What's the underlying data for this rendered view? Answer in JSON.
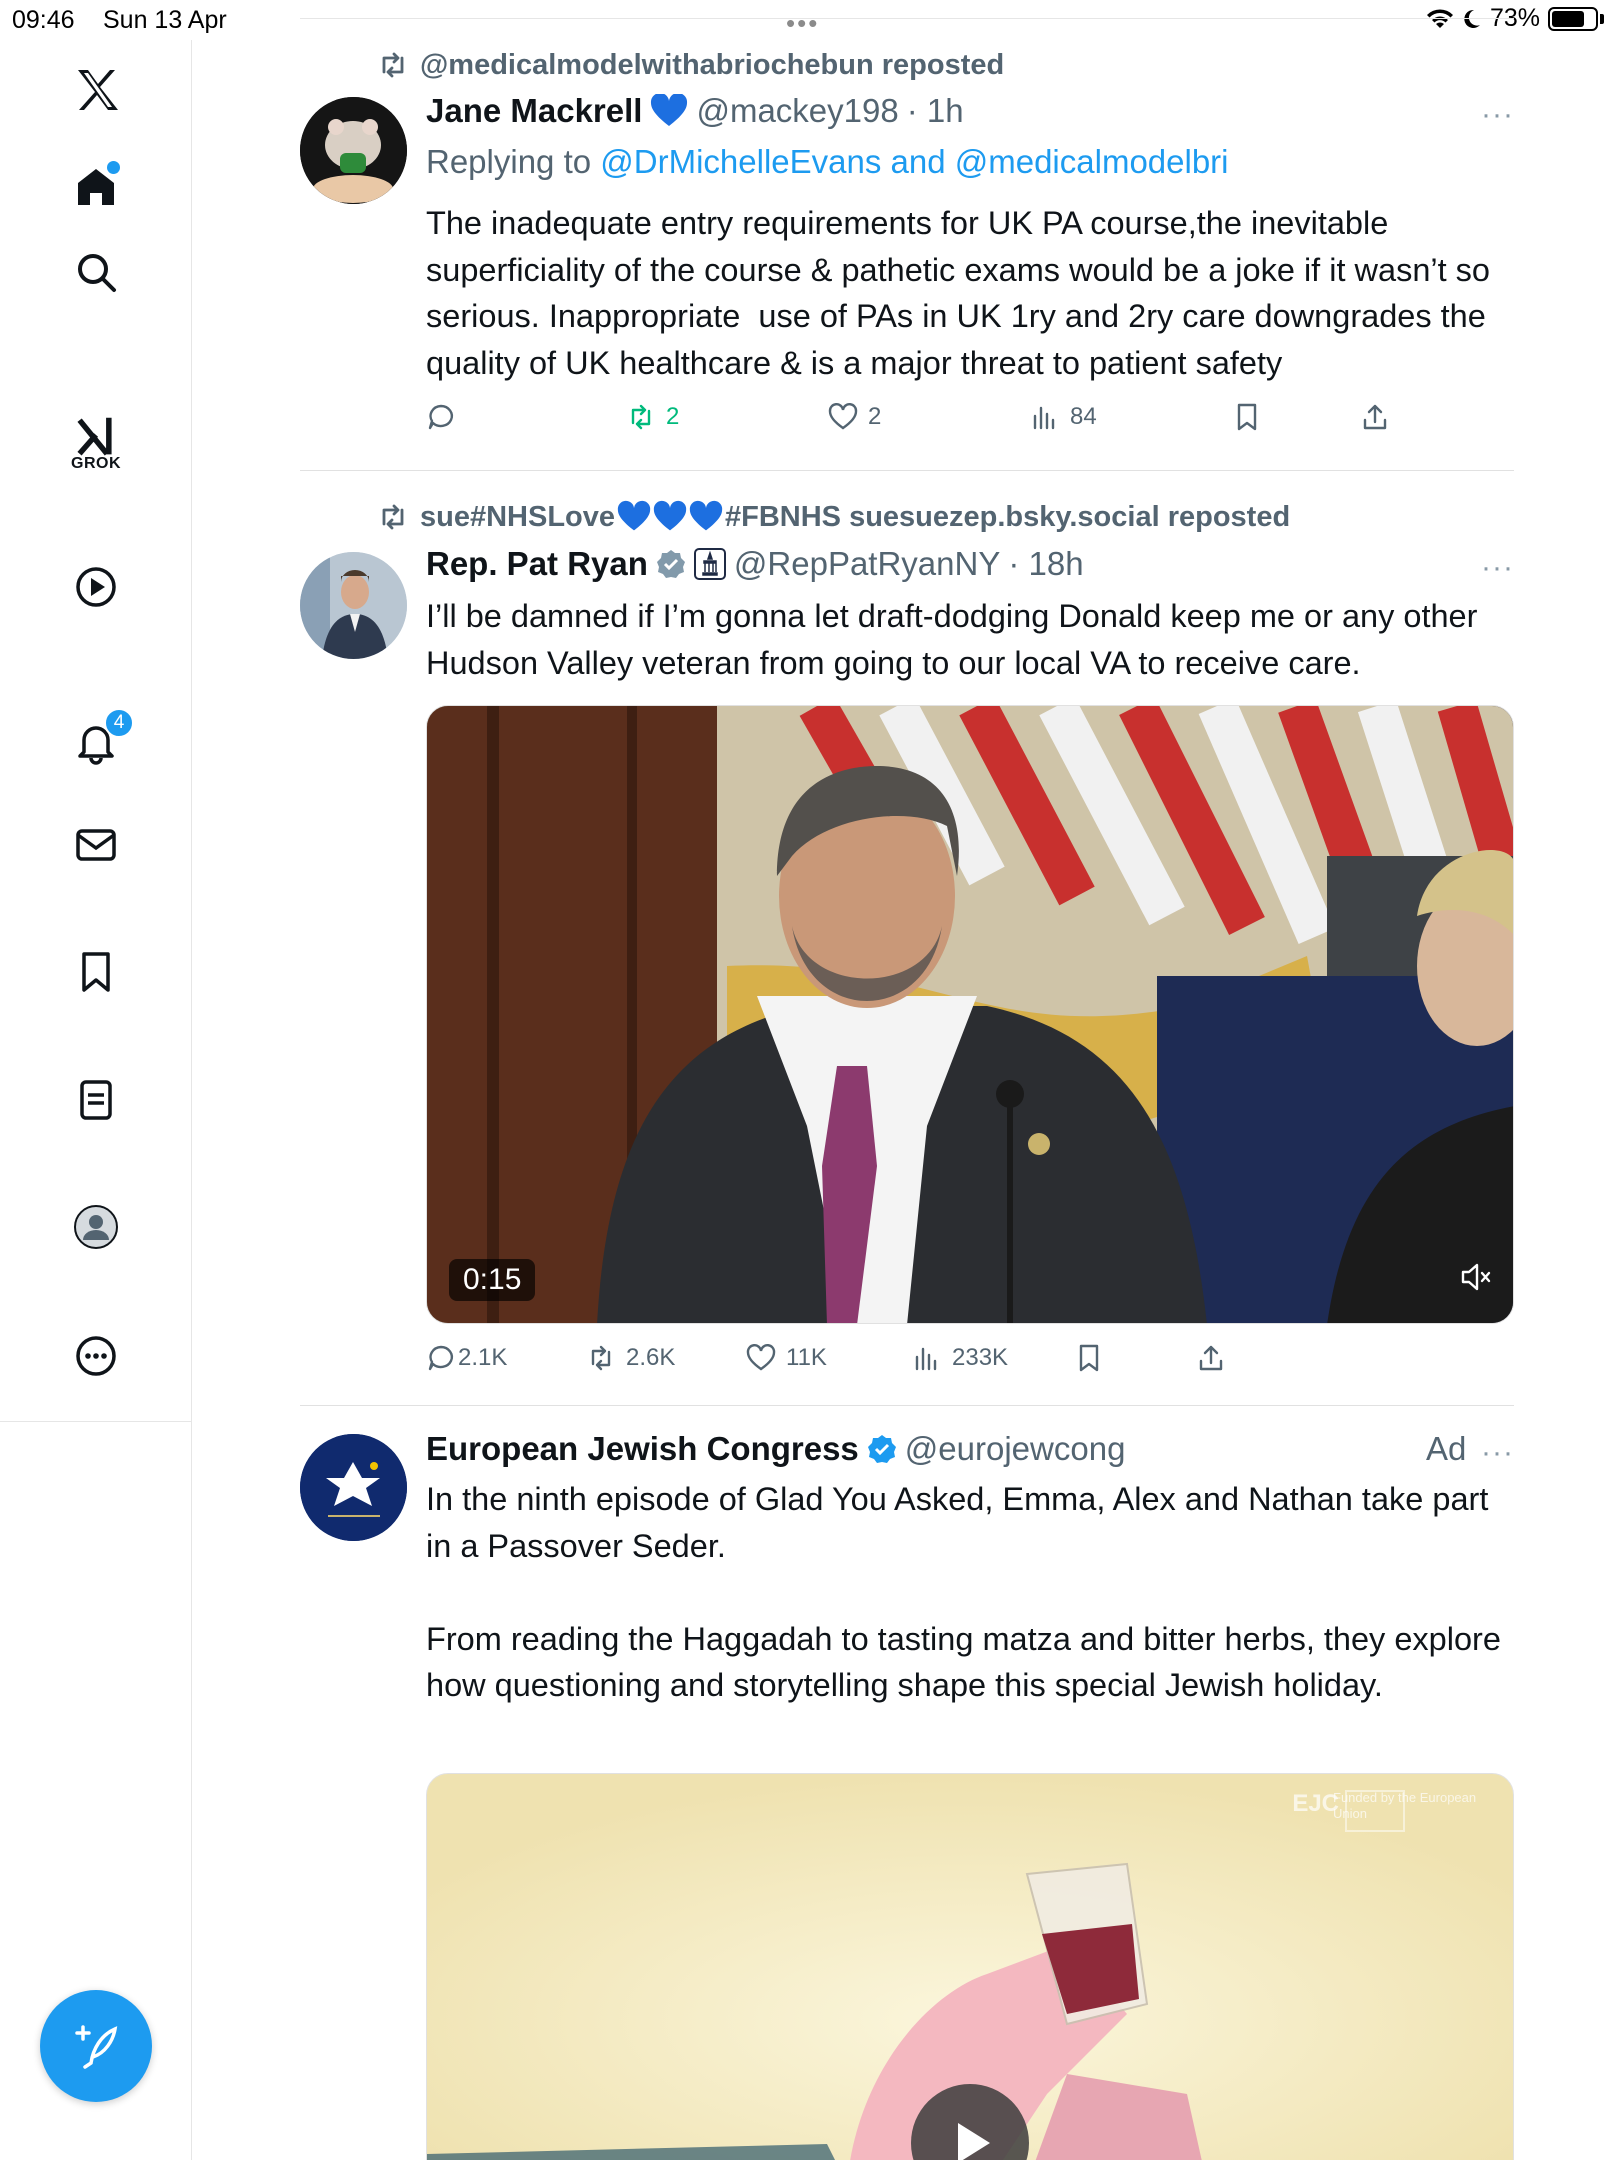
{
  "status_bar": {
    "time": "09:46",
    "date": "Sun 13 Apr",
    "battery": "73%"
  },
  "sidebar": {
    "grok_label": "GROK",
    "notifications_count": "4",
    "items": [
      "x-logo",
      "home",
      "search",
      "grok",
      "video",
      "notifications",
      "messages",
      "bookmarks",
      "lists",
      "profile",
      "more"
    ]
  },
  "posts": [
    {
      "repost_by": "@medicalmodelwithabriochebun reposted",
      "name": "Jane Mackrell",
      "handle": "@mackey198",
      "time": "· 1h",
      "reply_prefix": "Replying to ",
      "reply_to": "@DrMichelleEvans and @medicalmodelbri",
      "text": "The inadequate entry requirements for UK PA course,the inevitable superficiality of the course & pathetic exams would be a joke if it wasn’t so serious. Inappropriate  use of PAs in UK 1ry and 2ry care downgrades the quality of UK healthcare & is a major threat to patient safety",
      "reposts": "2",
      "likes": "2",
      "views": "84"
    },
    {
      "repost_by_a": "sue#NHSLove",
      "repost_by_b": "#FBNHS suesuezep.bsky.social reposted",
      "name": "Rep. Pat Ryan",
      "handle": "@RepPatRyanNY",
      "time": "· 18h",
      "text": "I’ll be damned if I’m gonna let draft-dodging Donald keep me or any other Hudson Valley veteran from going to our local VA to receive care.",
      "video_time": "0:15",
      "replies": "2.1K",
      "reposts": "2.6K",
      "likes": "11K",
      "views": "233K"
    },
    {
      "name": "European Jewish Congress",
      "handle": "@eurojewcong",
      "ad_label": "Ad",
      "text": "In the ninth episode of Glad You Asked, Emma, Alex and Nathan take part in a Passover Seder.\n\nFrom reading the Haggadah to tasting matza and bitter herbs, they explore how questioning and storytelling shape this special Jewish holiday.",
      "media_watermark": "EJC",
      "media_credit": "Funded by the European Union"
    }
  ],
  "more_label": "···",
  "colors": {
    "accent": "#1d9bf0",
    "repost_green": "#00ba7c",
    "muted": "#536471"
  }
}
